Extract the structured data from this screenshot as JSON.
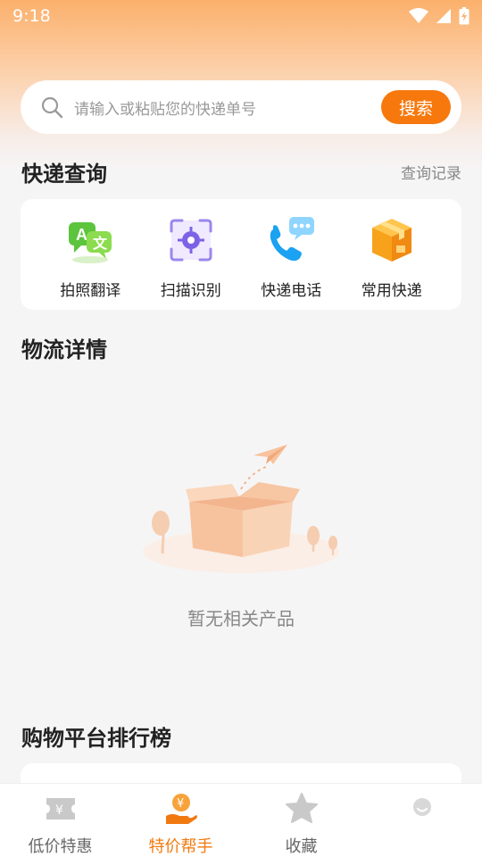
{
  "status_bar": {
    "time": "9:18"
  },
  "search": {
    "placeholder": "请输入或粘贴您的快递单号",
    "button_label": "搜索"
  },
  "express_query": {
    "title": "快递查询",
    "history_label": "查询记录",
    "tools": [
      {
        "label": "拍照翻译",
        "icon": "photo-translate-icon"
      },
      {
        "label": "扫描识别",
        "icon": "scan-icon"
      },
      {
        "label": "快递电话",
        "icon": "phone-icon"
      },
      {
        "label": "常用快递",
        "icon": "package-box-icon"
      }
    ]
  },
  "logistics": {
    "title": "物流详情",
    "empty_text": "暂无相关产品"
  },
  "ranking": {
    "title": "购物平台排行榜"
  },
  "tab_bar": {
    "tabs": [
      {
        "label": "低价特惠",
        "icon": "coupon-icon",
        "active": false
      },
      {
        "label": "特价帮手",
        "icon": "money-hand-icon",
        "active": true
      },
      {
        "label": "收藏",
        "icon": "star-icon",
        "active": false
      },
      {
        "label": "",
        "icon": "profile-icon",
        "active": false
      }
    ]
  },
  "colors": {
    "accent": "#f7780c",
    "active_tab": "#f07a10",
    "background": "#f6f5f6"
  }
}
